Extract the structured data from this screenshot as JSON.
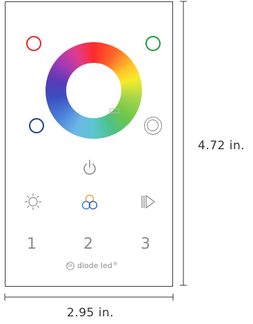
{
  "buttons": {
    "color_red": "red-preset",
    "color_green": "green-preset",
    "color_blue": "blue-preset",
    "color_white": "white-preset",
    "zone_1": "1",
    "zone_2": "2",
    "zone_3": "3"
  },
  "brand": {
    "logo_text": "DL",
    "name": "diode led",
    "trademark": "®"
  },
  "dimensions": {
    "width": "2.95 in.",
    "height": "4.72 in."
  },
  "colors": {
    "red": "#e0242c",
    "green": "#1f9a3a",
    "blue": "#1f3c8f",
    "outline": "#8a8a8a"
  },
  "icons": [
    "power-icon",
    "brightness-icon",
    "rgb-mix-icon",
    "play-next-icon"
  ]
}
